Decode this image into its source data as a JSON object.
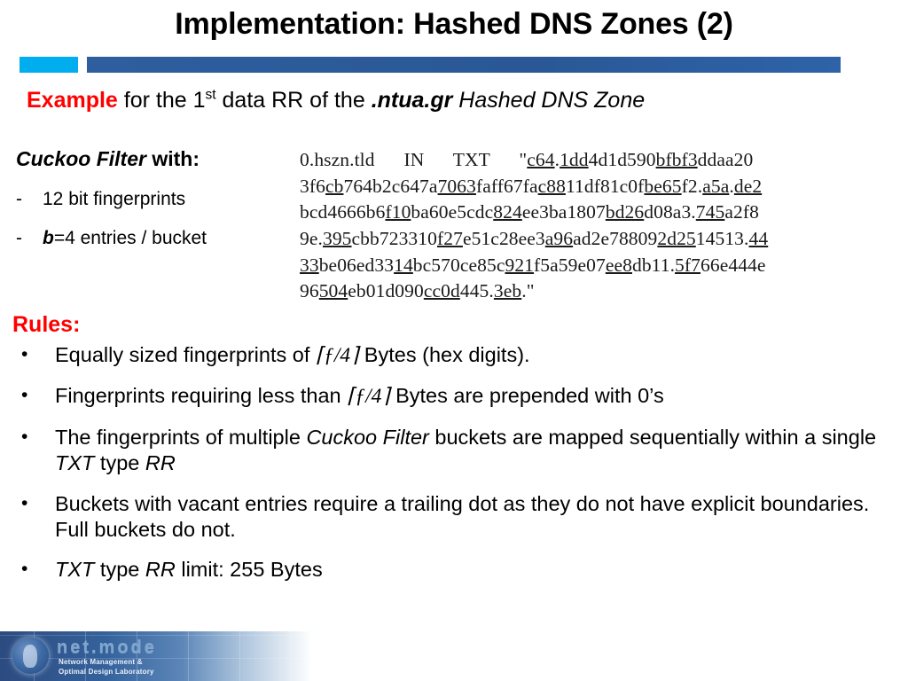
{
  "slide": {
    "title": "Implementation: Hashed DNS Zones (2)",
    "accent": {
      "cyan": "#00AEEF",
      "blue": "#2E5E9E"
    },
    "subtitle": {
      "keyword": "Example",
      "keyword_color": "#FF0000",
      "text_1": " for the 1",
      "ordinal": "st",
      "text_2": " data RR of the ",
      "domain": ".ntua.gr",
      "text_3": " Hashed DNS Zone"
    }
  },
  "cuckoo_filter": {
    "heading_italic": "Cuckoo Filter",
    "heading_rest": " with:",
    "items": [
      {
        "dash": "-",
        "text": "12 bit fingerprints",
        "bold_prefix": ""
      },
      {
        "dash": "-",
        "text": "=4 entries / bucket",
        "bold_prefix": "b"
      }
    ]
  },
  "dns_record": {
    "owner": "0.hszn.tld",
    "class": "IN",
    "type": "TXT",
    "lines": [
      "0.hszn.tld      IN      TXT      \"c64.1dd4d1d590bfbf3ddaa20",
      "3f6cb764b2c647a7063faff67fac8811df81c0fbe65f2.a5a.de2",
      "bcd4666b6f10ba60e5cdc824ee3ba1807bd26d08a3.745a2f8",
      "9e.395cbb723310f27e51c28ee3a96ad2e788092d2514513.44",
      "33be06ed3314bc570ce85c921f5a59e07ee8db11.5f766e444e",
      "96504eb01d090cc0d445.3eb.\""
    ],
    "underlined_fingerprints": [
      "c64",
      "1dd",
      "bfbf3",
      "cb",
      "7063",
      "c88",
      "be65",
      "a5a",
      "de2",
      "f10",
      "824",
      "bd26",
      "745",
      "395",
      "f27",
      "a96",
      "2d25",
      "44",
      "33",
      "14",
      "921",
      "ee8",
      "5f7",
      "504",
      "cc0d",
      "3eb"
    ]
  },
  "rules": {
    "heading": "Rules:",
    "heading_color": "#FF0000",
    "bullet_glyph": "•",
    "items": [
      {
        "parts": [
          {
            "t": "Equally sized fingerprints of ",
            "style": "normal"
          },
          {
            "t": "⌈ƒ/4⌉",
            "style": "math"
          },
          {
            "t": " Bytes (hex digits).",
            "style": "normal"
          }
        ]
      },
      {
        "parts": [
          {
            "t": "Fingerprints requiring less than ",
            "style": "normal"
          },
          {
            "t": "⌈ƒ/4⌉",
            "style": "math"
          },
          {
            "t": " Bytes are prepended with 0’s",
            "style": "normal"
          }
        ]
      },
      {
        "parts": [
          {
            "t": "The fingerprints of multiple ",
            "style": "normal"
          },
          {
            "t": "Cuckoo Filter",
            "style": "italic"
          },
          {
            "t": " buckets are mapped sequentially within a single ",
            "style": "normal"
          },
          {
            "t": "TXT",
            "style": "italic"
          },
          {
            "t": " type ",
            "style": "normal"
          },
          {
            "t": "RR",
            "style": "italic"
          }
        ]
      },
      {
        "parts": [
          {
            "t": "Buckets with vacant entries require a trailing dot as they do not have explicit boundaries. Full buckets do not.",
            "style": "normal"
          }
        ]
      },
      {
        "parts": [
          {
            "t": "TXT",
            "style": "italic"
          },
          {
            "t": " type ",
            "style": "normal"
          },
          {
            "t": "RR",
            "style": "italic"
          },
          {
            "t": " limit: 255 Bytes",
            "style": "normal"
          }
        ]
      }
    ]
  },
  "footer": {
    "brand": "net.mode",
    "tagline_line1": "Network Management &",
    "tagline_line2": "Optimal Design Laboratory"
  }
}
